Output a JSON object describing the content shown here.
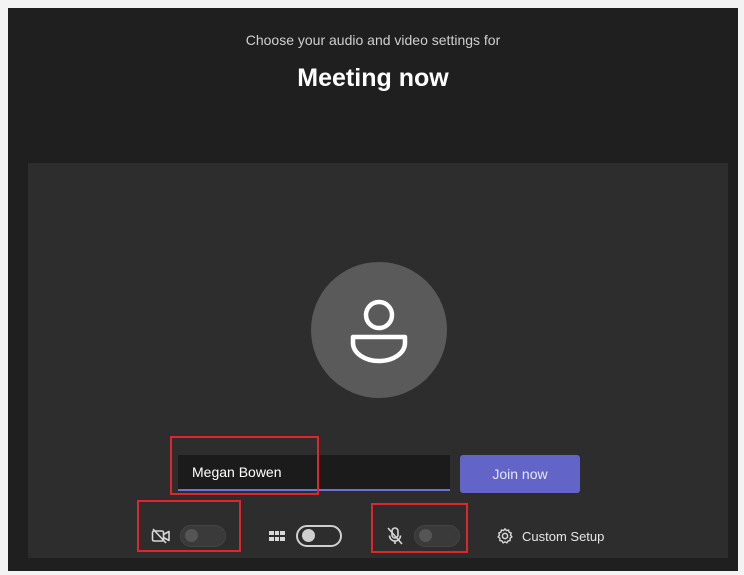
{
  "header": {
    "subtitle": "Choose your audio and video settings for",
    "title": "Meeting now"
  },
  "join": {
    "name_value": "Megan Bowen",
    "join_label": "Join now"
  },
  "controls": {
    "camera": {
      "icon": "camera-off-icon",
      "toggle_on": false
    },
    "background": {
      "icon": "background-effects-icon",
      "toggle_on": false
    },
    "mic": {
      "icon": "mic-off-icon",
      "toggle_on": false
    },
    "setup_label": "Custom Setup"
  },
  "colors": {
    "accent": "#6264c8",
    "highlight": "#e0252b",
    "background": "#1f1f1f",
    "preview": "#2d2d2d"
  }
}
